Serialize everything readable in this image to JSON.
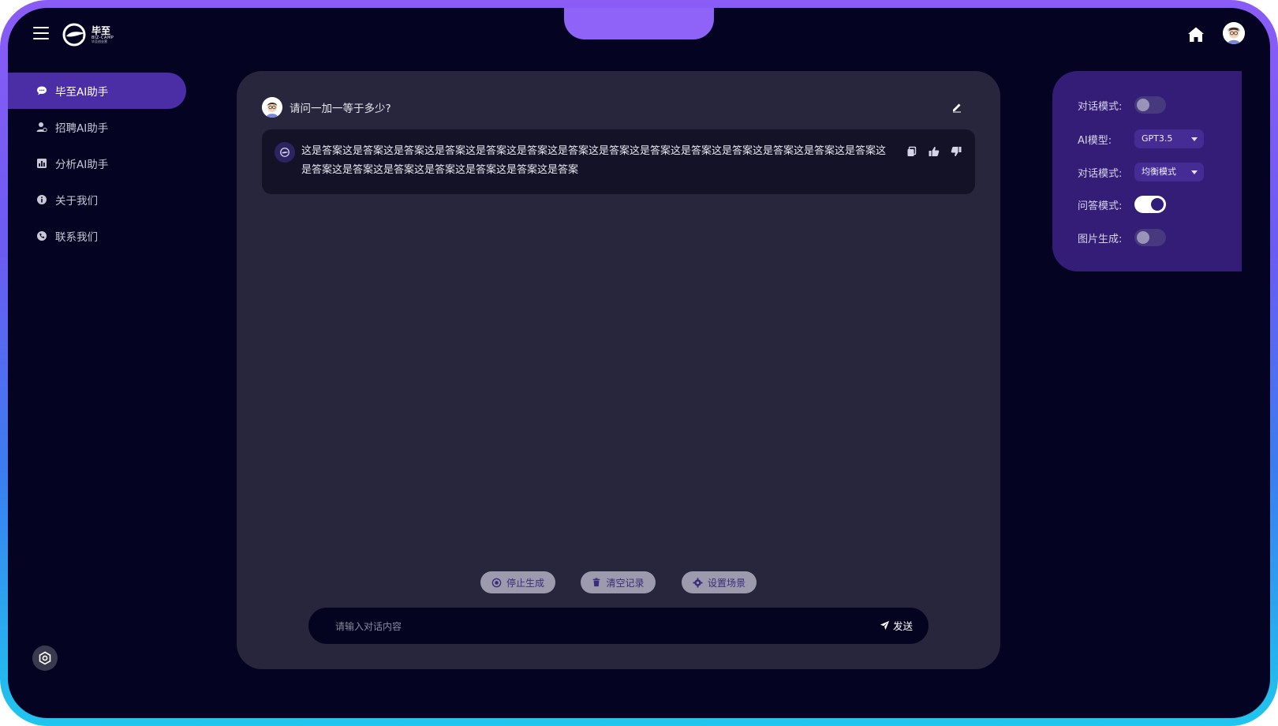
{
  "header": {
    "menu_icon": "hamburger-menu-icon",
    "logo": {
      "cn": "毕至",
      "en": "BIZ-CAMP",
      "sub": "毕至创业营"
    },
    "home_icon": "home-icon",
    "avatar_icon": "user-avatar-icon"
  },
  "sidebar": {
    "items": [
      {
        "label": "毕至AI助手",
        "icon": "chat-bubble-icon",
        "active": true
      },
      {
        "label": "招聘AI助手",
        "icon": "user-icon",
        "active": false
      },
      {
        "label": "分析AI助手",
        "icon": "bar-chart-icon",
        "active": false
      },
      {
        "label": "关于我们",
        "icon": "info-icon",
        "active": false
      },
      {
        "label": "联系我们",
        "icon": "phone-icon",
        "active": false
      }
    ],
    "settings_icon": "settings-gear-icon"
  },
  "chat": {
    "question": "请问一加一等于多少?",
    "answer": "这是答案这是答案这是答案这是答案这是答案这是答案这是答案这是答案这是答案这是答案这是答案这是答案这是答案这是答案这是答案这是答案这是答案这是答案这是答案这是答案这是答案",
    "actions": {
      "stop": "停止生成",
      "clear": "清空记录",
      "scene": "设置场景"
    },
    "input": {
      "placeholder": "请输入对话内容",
      "value": ""
    },
    "send_label": "发送"
  },
  "settings": {
    "dialog_mode_label": "对话模式:",
    "dialog_mode_on": false,
    "model_label": "AI模型:",
    "model_value": "GPT3.5",
    "style_label": "对话模式:",
    "style_value": "均衡模式",
    "qa_mode_label": "问答模式:",
    "qa_mode_on": true,
    "image_gen_label": "图片生成:",
    "image_gen_on": false
  },
  "colors": {
    "background": "#040321",
    "accent": "#4b2da5",
    "panel": "#28263d",
    "settings_panel": "#331d77"
  }
}
